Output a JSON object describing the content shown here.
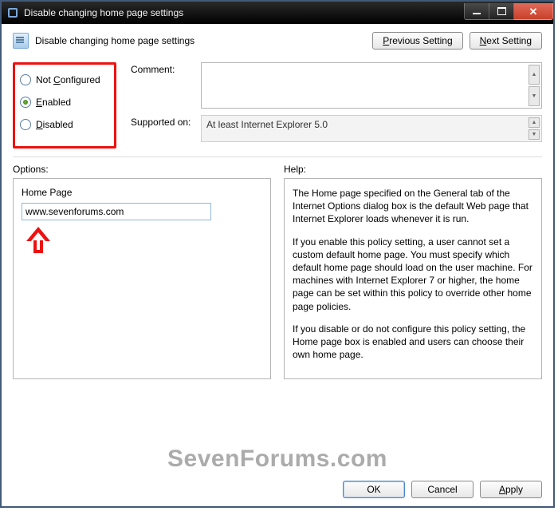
{
  "titlebar": {
    "title": "Disable changing home page settings"
  },
  "header": {
    "policy_title": "Disable changing home page settings",
    "prev_btn": "Previous Setting",
    "next_btn": "Next Setting",
    "prev_u": "P",
    "next_u": "N"
  },
  "state": {
    "not_configured_label": "Not Configured",
    "not_configured_u": "C",
    "enabled_label": "Enabled",
    "enabled_u": "E",
    "disabled_label": "Disabled",
    "disabled_u": "D",
    "selected": "enabled"
  },
  "fields": {
    "comment_label": "Comment:",
    "comment_value": "",
    "supported_label": "Supported on:",
    "supported_value": "At least Internet Explorer 5.0"
  },
  "options": {
    "section_label": "Options:",
    "homepage_label": "Home Page",
    "homepage_value": "www.sevenforums.com"
  },
  "help": {
    "section_label": "Help:",
    "p1": "The Home page specified on the General tab of the Internet Options dialog box is the default Web page that Internet Explorer loads whenever it is run.",
    "p2": "If you enable this policy setting, a user cannot set a custom default home page. You must specify which default home page should load on the user machine. For machines with Internet Explorer 7 or higher, the home page can be set within this policy to override other home page policies.",
    "p3": "If you disable or do not configure this policy setting, the Home page box is enabled and users can choose their own home page."
  },
  "footer": {
    "ok": "OK",
    "cancel": "Cancel",
    "apply": "Apply",
    "apply_u": "A"
  },
  "watermark": "SevenForums.com",
  "colors": {
    "accent_red": "#e11b1b"
  }
}
